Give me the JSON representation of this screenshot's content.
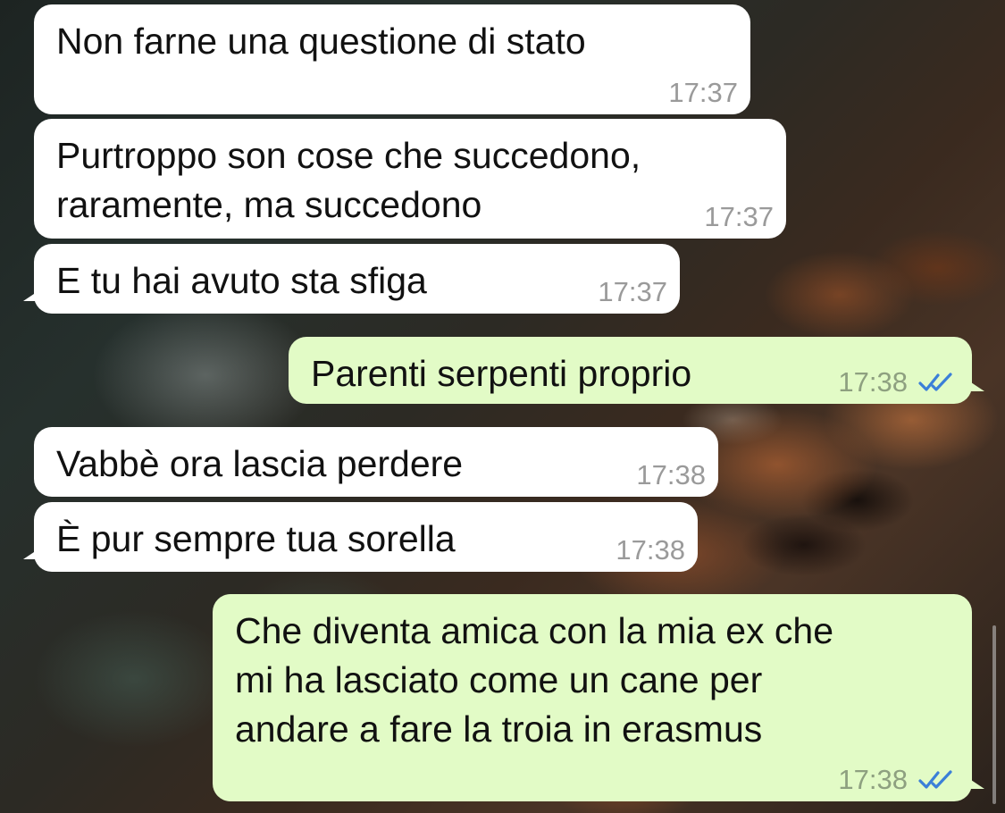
{
  "colors": {
    "incoming_bubble": "#ffffff",
    "outgoing_bubble": "#e2fbc6",
    "timestamp_gray": "#9a9a9a",
    "read_ticks_blue": "#3b7fd8"
  },
  "messages": [
    {
      "direction": "incoming",
      "text": "Non farne una questione di stato",
      "time": "17:37"
    },
    {
      "direction": "incoming",
      "text": "Purtroppo son cose che succedono,\nraramente, ma succedono",
      "time": "17:37"
    },
    {
      "direction": "incoming",
      "text": "E tu hai avuto sta sfiga",
      "time": "17:37"
    },
    {
      "direction": "outgoing",
      "text": "Parenti serpenti proprio",
      "time": "17:38",
      "status_icon": "double-check-read-icon"
    },
    {
      "direction": "incoming",
      "text": "Vabbè ora lascia perdere",
      "time": "17:38"
    },
    {
      "direction": "incoming",
      "text": "È pur sempre tua sorella",
      "time": "17:38"
    },
    {
      "direction": "outgoing",
      "text": "Che diventa amica con la mia ex che\nmi ha lasciato come un cane per\nandare a fare la troia in erasmus",
      "time": "17:38",
      "status_icon": "double-check-read-icon"
    }
  ]
}
